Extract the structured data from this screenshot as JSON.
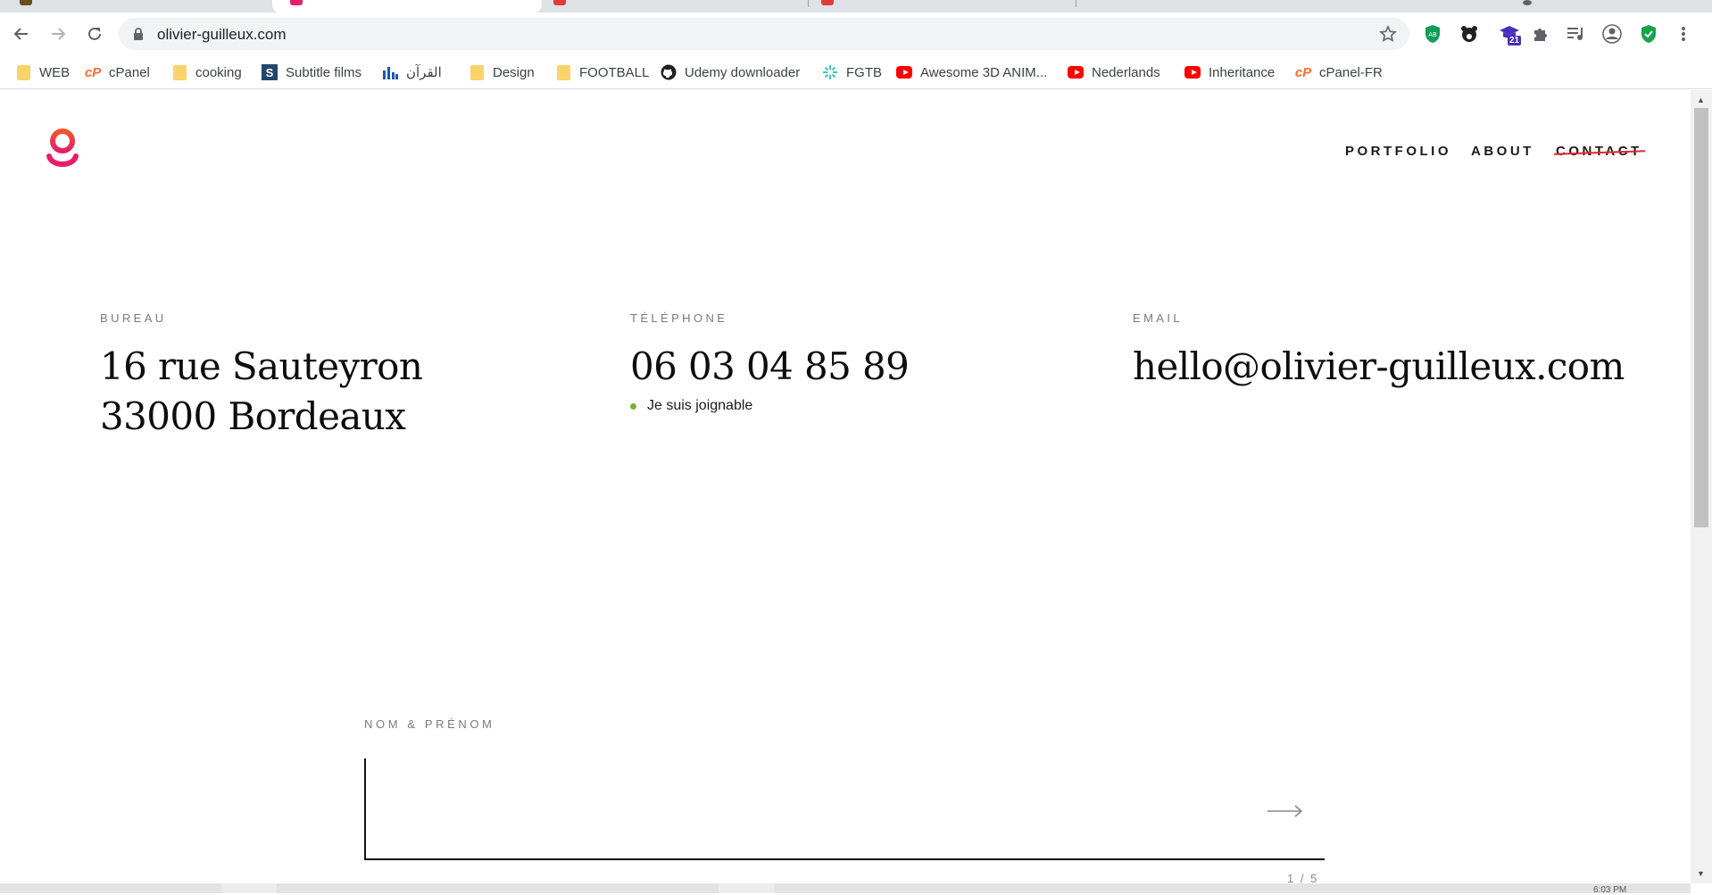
{
  "browser": {
    "url": "olivier-guilleux.com",
    "bookmarks": [
      {
        "label": "WEB",
        "icon": "folder-icon"
      },
      {
        "label": "cPanel",
        "icon": "cpanel-icon"
      },
      {
        "label": "cooking",
        "icon": "folder-icon"
      },
      {
        "label": "Subtitle films",
        "icon": "subtitle-s-icon"
      },
      {
        "label": "القرآن",
        "icon": "bar-chart-icon"
      },
      {
        "label": "Design",
        "icon": "folder-icon"
      },
      {
        "label": "FOOTBALL",
        "icon": "folder-icon"
      },
      {
        "label": "Udemy downloader",
        "icon": "github-icon"
      },
      {
        "label": "FGTB",
        "icon": "fgtb-icon"
      },
      {
        "label": "Awesome 3D ANIM...",
        "icon": "youtube-icon"
      },
      {
        "label": "Nederlands",
        "icon": "youtube-icon"
      },
      {
        "label": "Inheritance",
        "icon": "youtube-icon"
      },
      {
        "label": "cPanel-FR",
        "icon": "cpanel-icon"
      }
    ],
    "extension_badge": "21",
    "clock_partial": "6:03 PM"
  },
  "site": {
    "nav": {
      "portfolio": "PORTFOLIO",
      "about": "ABOUT",
      "contact": "CONTACT"
    },
    "bureau": {
      "label": "BUREAU",
      "line1": "16 rue Sauteyron",
      "line2": "33000 Bordeaux"
    },
    "telephone": {
      "label": "TÉLÉPHONE",
      "number": "06 03 04 85 89",
      "status": "Je suis joignable"
    },
    "email": {
      "label": "EMAIL",
      "address": "hello@olivier-guilleux.com"
    },
    "form": {
      "label": "NOM & PRÉNOM",
      "value": "",
      "pager": "1 / 5"
    }
  },
  "colors": {
    "logo_top": "#f2542d",
    "logo_bottom": "#e61f6b",
    "contact_strike": "#e2262d",
    "status_dot": "#7ab32e"
  }
}
